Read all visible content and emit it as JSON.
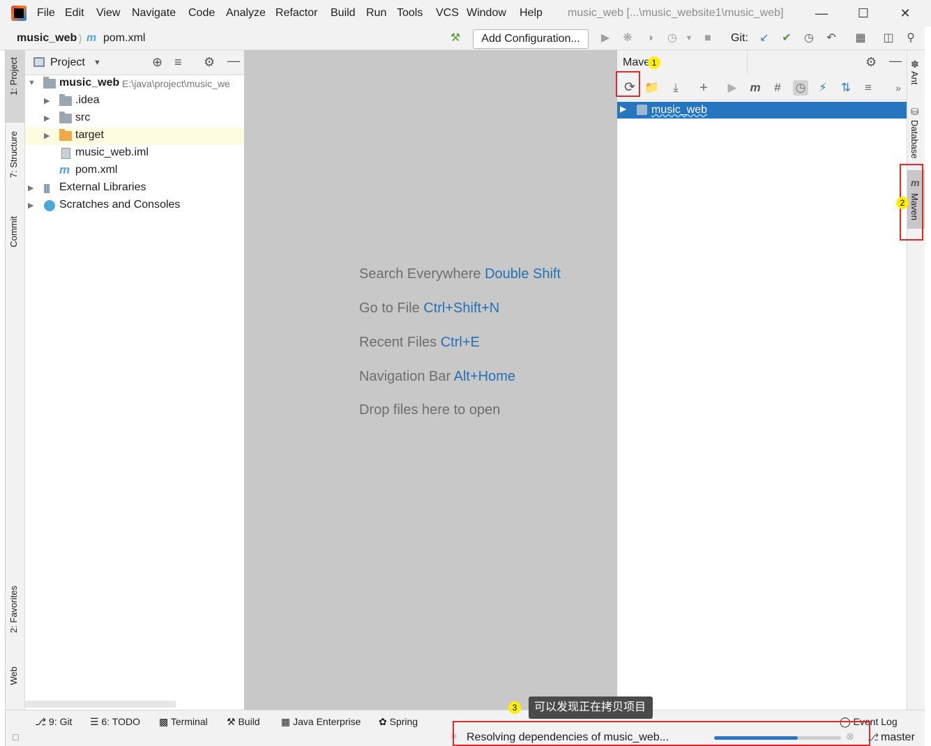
{
  "menubar": {
    "items": [
      {
        "label": "File"
      },
      {
        "label": "Edit"
      },
      {
        "label": "View"
      },
      {
        "label": "Navigate"
      },
      {
        "label": "Code"
      },
      {
        "label": "Analyze"
      },
      {
        "label": "Refactor"
      },
      {
        "label": "Build"
      },
      {
        "label": "Run"
      },
      {
        "label": "Tools"
      },
      {
        "label": "VCS"
      },
      {
        "label": "Window"
      },
      {
        "label": "Help"
      }
    ],
    "window_title": "music_web [...\\music_website1\\music_web]"
  },
  "navbar": {
    "project": "music_web",
    "file": "pom.xml",
    "add_config_label": "Add Configuration...",
    "git_label": "Git:"
  },
  "left_tabs": {
    "project": "1: Project",
    "structure": "7: Structure",
    "commit": "Commit",
    "favorites": "2: Favorites",
    "web": "Web"
  },
  "project_panel": {
    "title": "Project",
    "root_name": "music_web",
    "root_path": "E:\\java\\project\\music_we",
    "items": [
      {
        "label": ".idea"
      },
      {
        "label": "src"
      },
      {
        "label": "target"
      },
      {
        "label": "music_web.iml"
      },
      {
        "label": "pom.xml"
      },
      {
        "label": "External Libraries"
      },
      {
        "label": "Scratches and Consoles"
      }
    ]
  },
  "editor": {
    "hints": [
      {
        "text": "Search Everywhere",
        "key": "Double Shift"
      },
      {
        "text": "Go to File",
        "key": "Ctrl+Shift+N"
      },
      {
        "text": "Recent Files",
        "key": "Ctrl+E"
      },
      {
        "text": "Navigation Bar",
        "key": "Alt+Home"
      },
      {
        "text": "Drop files here to open",
        "key": ""
      }
    ]
  },
  "maven": {
    "title": "Mave",
    "project": "music_web"
  },
  "right_tabs": {
    "ant": "Ant",
    "database": "Database",
    "maven": "Maven"
  },
  "bottom_tabs": {
    "git": "9: Git",
    "todo": "6: TODO",
    "terminal": "Terminal",
    "build": "Build",
    "java_enterprise": "Java Enterprise",
    "spring": "Spring",
    "event_log": "Event Log"
  },
  "status": {
    "message": "Resolving dependencies of music_web...",
    "progress": 0.66,
    "branch": "master"
  },
  "annotations": {
    "badge1": "1",
    "badge2": "2",
    "badge3": "3",
    "tooltip": "可以发现正在拷贝项目"
  },
  "colors": {
    "accent": "#2675bf",
    "highlight_box": "#e02a2a",
    "badge": "#ffee00"
  }
}
